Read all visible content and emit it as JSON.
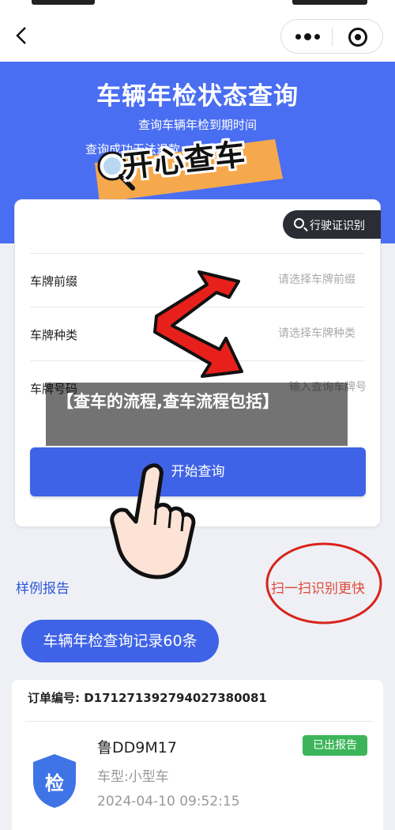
{
  "nav": {
    "back_icon": "back-arrow-icon",
    "more_icon": "more-dots-icon",
    "close_icon": "target-close-icon"
  },
  "hero": {
    "title": "车辆年检状态查询",
    "subtitle1": "查询车辆年检到期时间",
    "subtitle2": "查询成功无法退款"
  },
  "sticker": {
    "text": "开心查车"
  },
  "form": {
    "ocr_button": "行驶证识别",
    "rows": [
      {
        "label": "车牌前缀",
        "placeholder": "请选择车牌前缀"
      },
      {
        "label": "车牌种类",
        "placeholder": "请选择车牌种类"
      },
      {
        "label": "车牌号码",
        "placeholder": "输入查询车牌号"
      }
    ],
    "submit": "开始查询"
  },
  "overlay": {
    "text": "【查车的流程,查车流程包括】"
  },
  "links": {
    "sample_report": "样例报告",
    "scan_fast": "扫一扫识别更快"
  },
  "history": {
    "label": "车辆年检查询记录60条"
  },
  "record": {
    "order_no": "订单编号: D171271392794027380081",
    "plate": "鲁DD9M17",
    "status": "已出报告",
    "car_type": "车型:小型车",
    "time": "2024-04-10 09:52:15",
    "icon_char": "检"
  },
  "colors": {
    "brand_blue": "#4a6ef2",
    "button_blue": "#3f63e6",
    "link_blue": "#2f56d8",
    "badge_green": "#3cb55a",
    "annotation_red": "#e0483c"
  }
}
